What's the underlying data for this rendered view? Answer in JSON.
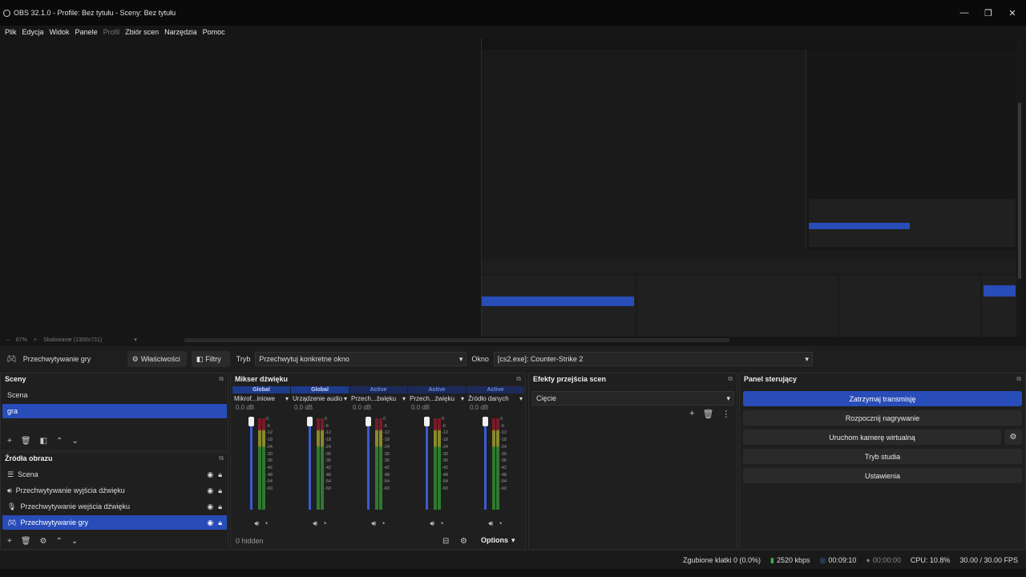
{
  "window": {
    "title": "OBS 32.1.0 - Profile: Bez tytułu - Sceny: Bez tytułu"
  },
  "menu": [
    "Plik",
    "Edycja",
    "Widok",
    "Panele",
    "Profil",
    "Zbiór scen",
    "Narzędzia",
    "Pomoc"
  ],
  "zoom": {
    "minus": "–",
    "value": "67%",
    "plus": "+",
    "scale_label": "Skalowanie (1300x731)"
  },
  "source_bar": {
    "source_name": "Przechwytywanie gry",
    "properties_label": "Właściwości",
    "filters_label": "Filtry",
    "mode_label": "Tryb",
    "mode_value": "Przechwytuj konkretne okno",
    "window_label": "Okno",
    "window_value": "[cs2.exe]: Counter-Strike 2"
  },
  "scenes": {
    "title": "Sceny",
    "items": [
      {
        "label": "Scena",
        "selected": false
      },
      {
        "label": "gra",
        "selected": true
      }
    ]
  },
  "sources": {
    "title": "Źródła obrazu",
    "items": [
      {
        "label": "Scena",
        "icon": "list-icon",
        "selected": false
      },
      {
        "label": "Przechwytywanie wyjścia dźwięku",
        "icon": "speaker-icon",
        "selected": false
      },
      {
        "label": "Przechwytywanie wejścia dźwięku",
        "icon": "mic-icon",
        "selected": false
      },
      {
        "label": "Przechwytywanie gry",
        "icon": "gamepad-icon",
        "selected": true
      }
    ]
  },
  "mixer": {
    "title": "Mikser dźwięku",
    "hidden_label": "0 hidden",
    "options_label": "Options",
    "scale": [
      "0",
      "-6",
      "-12",
      "-18",
      "-24",
      "-30",
      "-36",
      "-42",
      "-48",
      "-54",
      "-60"
    ],
    "channels": [
      {
        "badge": "Global",
        "name": "Mikrof...iniowe",
        "db": "0.0 dB"
      },
      {
        "badge": "Global",
        "name": "Urządzenie audio",
        "db": "0.0 dB"
      },
      {
        "badge": "Active",
        "name": "Przech...źwięku",
        "db": "0.0 dB"
      },
      {
        "badge": "Active",
        "name": "Przech...źwięku",
        "db": "0.0 dB"
      },
      {
        "badge": "Active",
        "name": "Źródło danych",
        "db": "0.0 dB"
      }
    ]
  },
  "transitions": {
    "title": "Efekty przejścia scen",
    "value": "Cięcie"
  },
  "controls": {
    "title": "Panel sterujący",
    "buttons": [
      {
        "label": "Zatrzymaj transmisję",
        "active": true
      },
      {
        "label": "Rozpocznij nagrywanie",
        "active": false
      },
      {
        "label": "Uruchom kamerę wirtualną",
        "active": false
      },
      {
        "label": "Tryb studia",
        "active": false
      },
      {
        "label": "Ustawienia",
        "active": false
      }
    ]
  },
  "status": {
    "dropped_frames": "Zgubione klatki 0 (0.0%)",
    "bitrate": "2520 kbps",
    "stream_time": "00:09:10",
    "record_time": "00:00:00",
    "cpu": "CPU: 10.8%",
    "fps": "30.00 / 30.00 FPS"
  },
  "colors": {
    "accent": "#284cb8",
    "background": "#1e1e1e"
  }
}
